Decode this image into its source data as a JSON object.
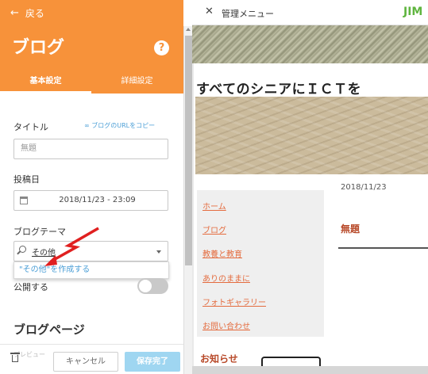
{
  "panel": {
    "back_label": "戻る",
    "title": "ブログ",
    "help_symbol": "?",
    "tabs": [
      {
        "label": "基本設定",
        "active": true
      },
      {
        "label": "詳細設定",
        "active": false
      }
    ],
    "title_field": {
      "label": "タイトル",
      "placeholder": "無題",
      "copy_link": "ブログのURLをコピー"
    },
    "date_field": {
      "label": "投稿日",
      "value": "2018/11/23 - 23:09"
    },
    "theme_field": {
      "label": "ブログテーマ",
      "value": "その他",
      "suggestion": "\"その他\"を作成する"
    },
    "publish": {
      "label": "公開する",
      "enabled": false
    },
    "section_title": "ブログページ",
    "footer_faint": "プレビュー",
    "cancel_label": "キャンセル",
    "save_label": "保存完了"
  },
  "preview": {
    "close_symbol": "✕",
    "menu_label": "管理メニュー",
    "logo_text": "JIM",
    "site_title": "すべてのシニアにＩＣＴを",
    "nav_items": [
      "ホーム",
      "ブログ",
      "教養と教育",
      "ありのままに",
      "フォトギャラリー",
      "お問い合わせ"
    ],
    "post_date": "2018/11/23",
    "post_title": "無題",
    "news_title": "お知らせ"
  },
  "colors": {
    "header_orange": "#f7923a",
    "link_blue": "#4a9ed6",
    "nav_link": "#e46c3f",
    "accent_red": "#b84a2a",
    "annotation_arrow": "#e02020"
  },
  "icons": [
    "back-arrow-icon",
    "help-icon",
    "link-icon",
    "calendar-icon",
    "search-icon",
    "chevron-down-icon",
    "trash-icon",
    "close-icon"
  ]
}
